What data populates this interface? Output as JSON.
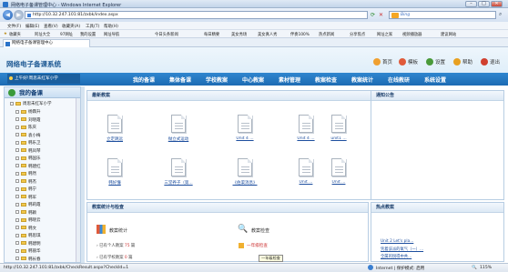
{
  "window": {
    "title": "网络电子备课管理中心 - Windows Internet Explorer",
    "minimize": "–",
    "maximize": "□",
    "close": "✕"
  },
  "browser": {
    "address": "http://10.32.247.101:81/zxbk/index.aspx",
    "search_placeholder": "Bing",
    "menu": [
      "文件(F)",
      "编辑(E)",
      "查看(V)",
      "收藏夹(A)",
      "工具(T)",
      "帮助(H)"
    ],
    "favorites_label": "收藏夹",
    "favorites": [
      "阿址大全",
      "97网址",
      "我的设置",
      "网址导航",
      "今日头条新闻",
      "每日精要",
      "美女秀场",
      "美女真人秀",
      "伴奏100%",
      "热点新闻",
      "分享焦点",
      "网址之家",
      "视频播放器",
      "建议网站"
    ],
    "tab": "网络电子备课管理中心"
  },
  "header": {
    "logo": "网络电子备课系统",
    "links": [
      "首页",
      "模板",
      "设置",
      "帮助",
      "退出"
    ],
    "greeting": "上午好!周思未红军小学",
    "nav": [
      "我的备课",
      "集体备课",
      "学校教案",
      "中心教案",
      "素材管理",
      "教案检查",
      "教案统计",
      "在线教研",
      "系统设置"
    ]
  },
  "sidebar": {
    "title": "我的备课",
    "root": "周思未红军小学",
    "items": [
      "杨霖升",
      "刘晓霞",
      "陈庆",
      "袁小梅",
      "韩乐卫",
      "韩凤琴",
      "韩国乐",
      "韩建红",
      "韩然",
      "韩杰",
      "韩宁",
      "韩军",
      "韩莉霞",
      "韩颖",
      "韩晓云",
      "韩文",
      "韩思琪",
      "韩建明",
      "韩丽华",
      "韩长春"
    ]
  },
  "latest": {
    "title": "最新教案",
    "docs_row1": [
      "立定跳远",
      "抛立式运动",
      "Unit 4 ...",
      "Unit 4 ...",
      "unit1 ..."
    ],
    "docs_row2": [
      "韩好懂",
      "三堂养子（第...",
      "《伯渠消息》",
      "Unit ...",
      "Unit ..."
    ]
  },
  "notice": {
    "title": "通知公告"
  },
  "stats": {
    "title": "教案统计与检查",
    "count_label": "教案统计",
    "check_label": "教案检查",
    "shared_label": "已有个人教案",
    "shared_value": "75",
    "school_label": "已有学校教案",
    "school_value": "0",
    "review_link": "一年级检查",
    "tooltip": "一年级检查"
  },
  "hot": {
    "title": "热点教案",
    "items": [
      "Unit 2 Let's pla...",
      "凭着该派的氧气（一）...",
      "全属的锐得中共..."
    ]
  },
  "status": {
    "url": "http://10.32.247.101:81/zxbk/CheckResult.aspx?CheckId=1",
    "zone": "Internet | 保护模式: 启用",
    "zoom": "115%"
  },
  "colors": {
    "nav": "#2277c1",
    "header_bg": "#e4f1fb",
    "link": "#1d4e9e"
  }
}
